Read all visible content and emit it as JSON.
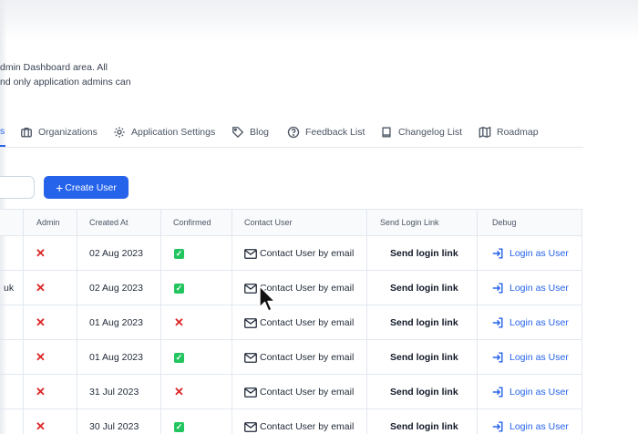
{
  "intro": {
    "line1": "dmin Dashboard area. All",
    "line2": "nd only application admins can"
  },
  "tabs": [
    {
      "label": "s",
      "icon": "users-icon",
      "active": true
    },
    {
      "label": "Organizations",
      "icon": "briefcase-icon"
    },
    {
      "label": "Application Settings",
      "icon": "gear-icon"
    },
    {
      "label": "Blog",
      "icon": "tag-icon"
    },
    {
      "label": "Feedback List",
      "icon": "question-circle-icon"
    },
    {
      "label": "Changelog List",
      "icon": "book-icon"
    },
    {
      "label": "Roadmap",
      "icon": "map-icon"
    }
  ],
  "toolbar": {
    "create_label": "Create User",
    "create_icon": "plus-icon"
  },
  "table": {
    "columns": [
      "Admin",
      "Created At",
      "Confirmed",
      "Contact User",
      "Send Login Link",
      "Debug"
    ],
    "rows": [
      {
        "name_frag": "",
        "admin": false,
        "created": "02 Aug 2023",
        "confirmed": true,
        "contact": "Contact User by email",
        "send": "Send login link",
        "debug": "Login as User"
      },
      {
        "name_frag": "uk",
        "admin": false,
        "created": "02 Aug 2023",
        "confirmed": true,
        "contact": "Contact User by email",
        "send": "Send login link",
        "debug": "Login as User"
      },
      {
        "name_frag": "",
        "admin": false,
        "created": "01 Aug 2023",
        "confirmed": false,
        "contact": "Contact User by email",
        "send": "Send login link",
        "debug": "Login as User"
      },
      {
        "name_frag": "",
        "admin": false,
        "created": "01 Aug 2023",
        "confirmed": true,
        "contact": "Contact User by email",
        "send": "Send login link",
        "debug": "Login as User"
      },
      {
        "name_frag": "",
        "admin": false,
        "created": "31 Jul 2023",
        "confirmed": false,
        "contact": "Contact User by email",
        "send": "Send login link",
        "debug": "Login as User"
      },
      {
        "name_frag": "",
        "admin": false,
        "created": "30 Jul 2023",
        "confirmed": true,
        "contact": "Contact User by email",
        "send": "Send login link",
        "debug": "Login as User"
      }
    ]
  },
  "colors": {
    "accent": "#2563eb",
    "danger": "#dc2626",
    "success": "#22c55e",
    "border": "#e2e8f0"
  }
}
